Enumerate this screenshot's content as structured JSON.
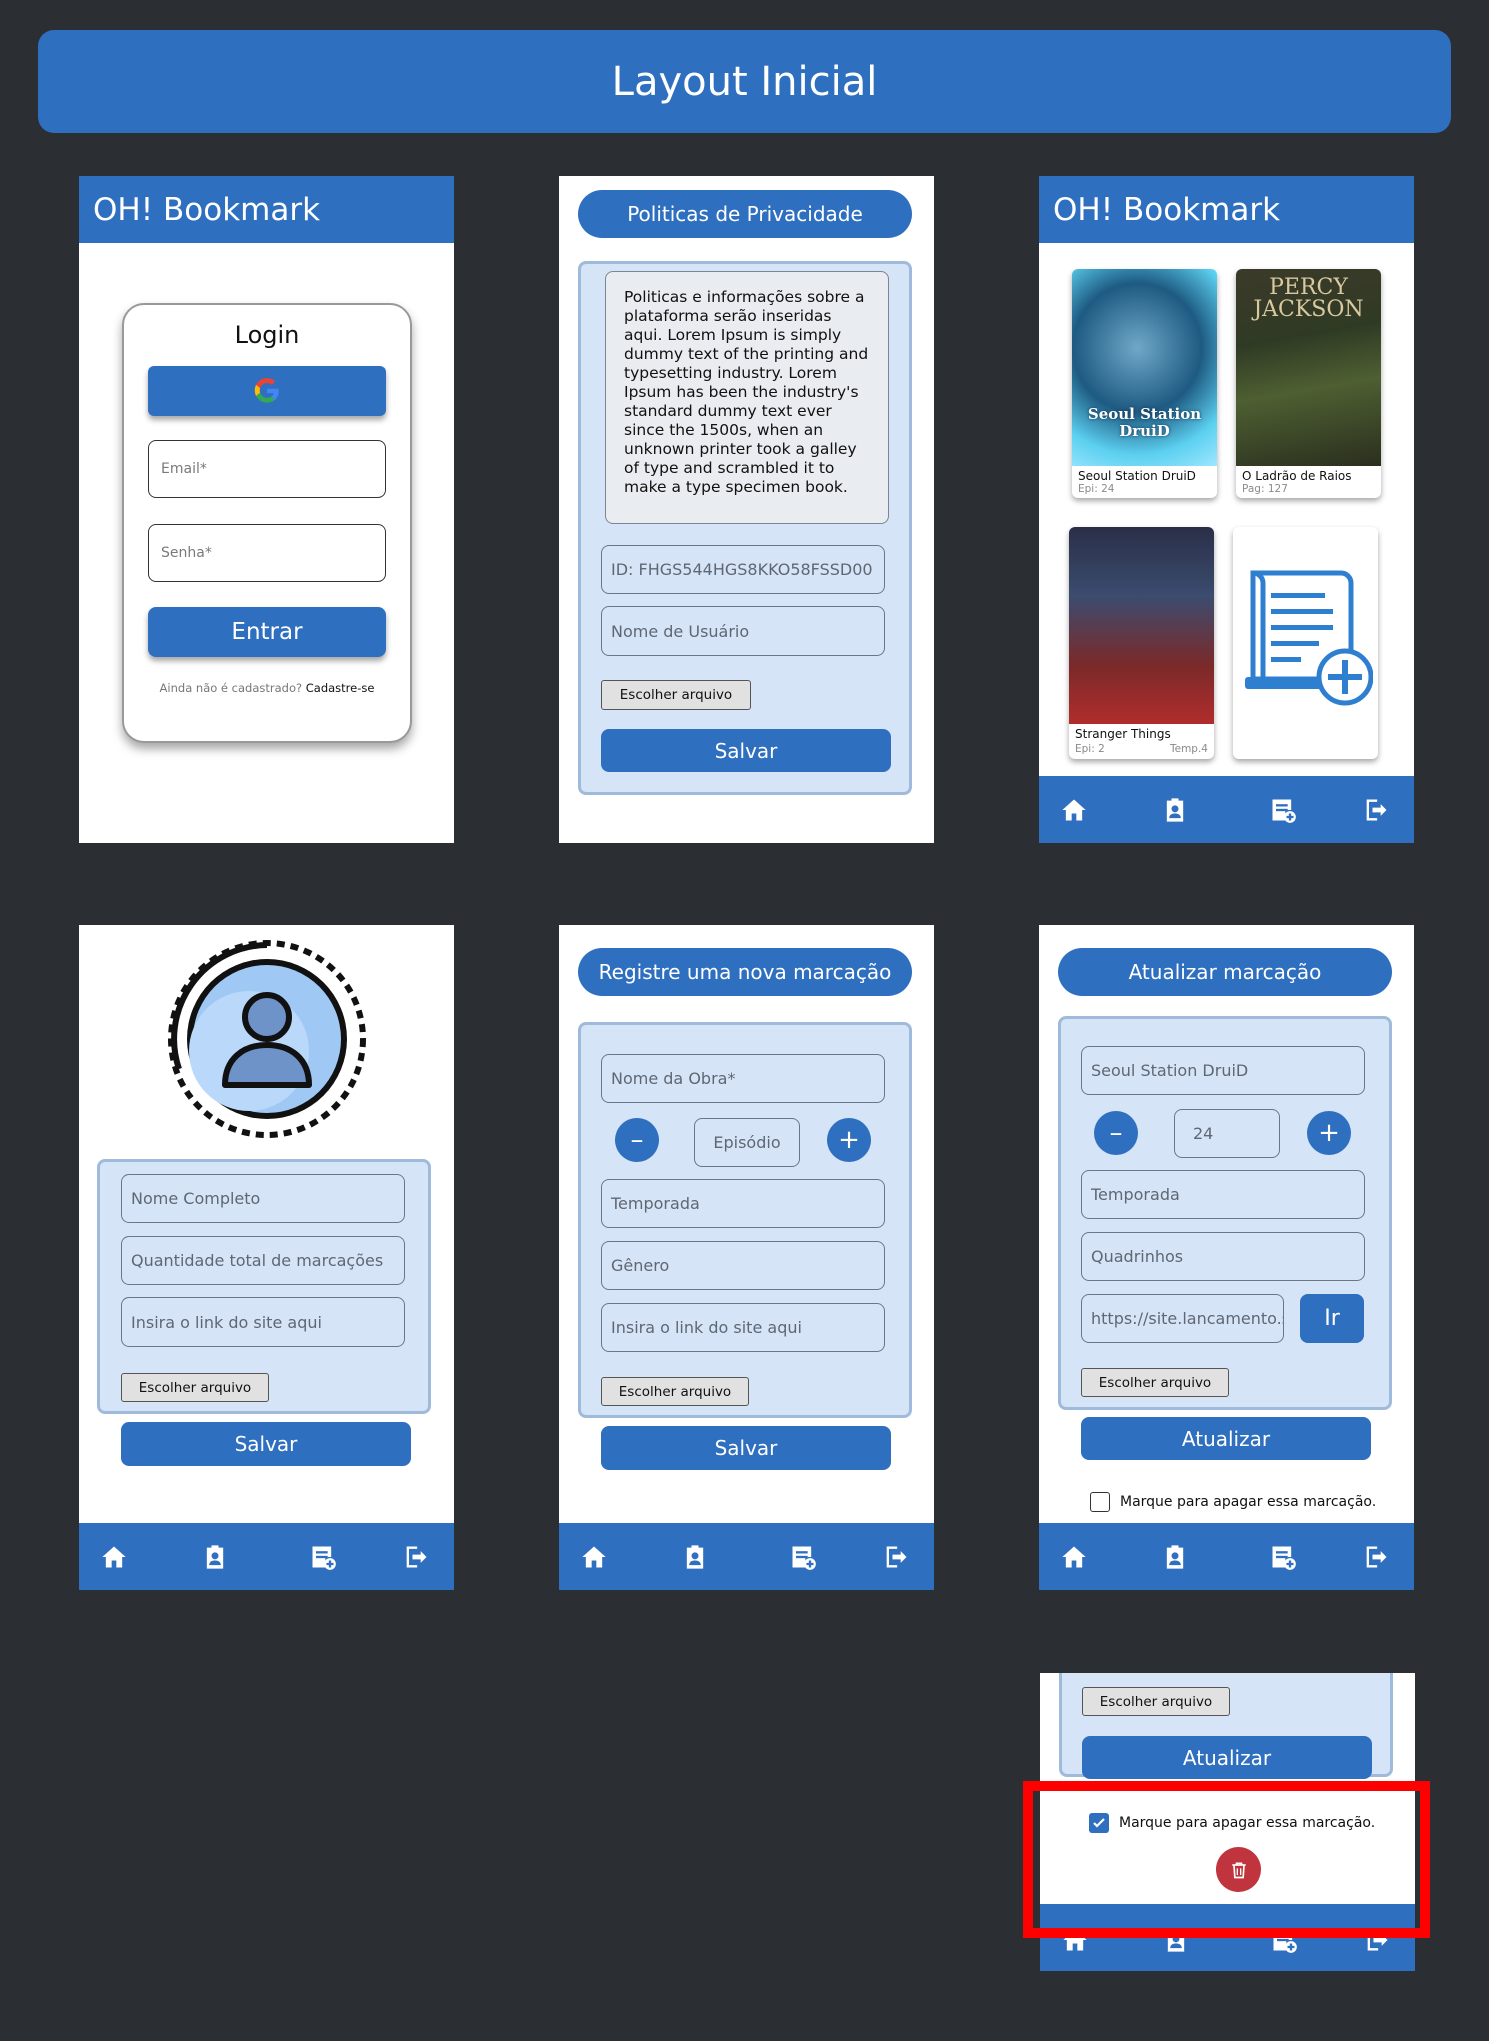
{
  "page": {
    "title": "Layout Inicial"
  },
  "login_screen": {
    "app_title": "OH! Bookmark",
    "card_title": "Login",
    "google_icon": "google-icon",
    "email_placeholder": "Email*",
    "password_placeholder": "Senha*",
    "submit_label": "Entrar",
    "signup_prompt": "Ainda não é cadastrado?",
    "signup_link": "Cadastre-se"
  },
  "privacy_screen": {
    "header": "Politicas de Privacidade",
    "policy_text": "Politicas e informações sobre a plataforma serão inseridas aqui. Lorem Ipsum is simply dummy text of the printing and typesetting industry. Lorem Ipsum has been the industry's standard dummy text ever since the 1500s, when an unknown printer took a galley of type and scrambled it to make a type specimen book.",
    "id_value": "ID: FHGS544HGS8KKO58FSSD00",
    "username_placeholder": "Nome de Usuário",
    "file_button": "Escolher arquivo",
    "save_label": "Salvar"
  },
  "home_screen": {
    "app_title": "OH! Bookmark",
    "cards": [
      {
        "title": "Seoul Station DruiD",
        "meta_left": "Epi: 24",
        "meta_right": "",
        "cover_text": "Seoul Station DruiD"
      },
      {
        "title": "O Ladrão de Raios",
        "meta_left": "Pag: 127",
        "meta_right": "",
        "cover_text": "PERCY JACKSON"
      },
      {
        "title": "Stranger Things",
        "meta_left": "Epi: 2",
        "meta_right": "Temp.4",
        "cover_text": ""
      }
    ],
    "add_card_icon": "add-document-icon"
  },
  "nav_icons": [
    "home-icon",
    "profile-badge-icon",
    "add-bookmark-icon",
    "logout-icon"
  ],
  "profile_screen": {
    "avatar_icon": "user-avatar-icon",
    "fullname_placeholder": "Nome Completo",
    "total_placeholder": "Quantidade total de marcações",
    "link_placeholder": "Insira o link do site aqui",
    "file_button": "Escolher arquivo",
    "save_label": "Salvar"
  },
  "register_screen": {
    "header": "Registre uma nova marcação",
    "work_placeholder": "Nome da Obra*",
    "episode_placeholder": "Episódio",
    "minus": "–",
    "plus": "+",
    "season_placeholder": "Temporada",
    "genre_placeholder": "Gênero",
    "link_placeholder": "Insira o link do site aqui",
    "file_button": "Escolher arquivo",
    "save_label": "Salvar"
  },
  "update_screen": {
    "header": "Atualizar marcação",
    "work_value": "Seoul Station DruiD",
    "episode_value": "24",
    "minus": "–",
    "plus": "+",
    "season_placeholder": "Temporada",
    "type_value": "Quadrinhos",
    "link_value": "https://site.lancamento.s",
    "go_label": "Ir",
    "file_button": "Escolher arquivo",
    "update_label": "Atualizar",
    "delete_checkbox_label": "Marque para apagar essa marcação.",
    "delete_checked": false
  },
  "delete_detail": {
    "file_button": "Escolher arquivo",
    "update_label": "Atualizar",
    "delete_checkbox_label": "Marque para apagar essa marcação.",
    "delete_checked": true,
    "delete_icon": "trash-icon",
    "highlight_color": "#ff0000"
  },
  "colors": {
    "background": "#2b2e33",
    "primary": "#2f6fbf",
    "panel": "#d6e4f7",
    "danger": "#c0353d"
  }
}
